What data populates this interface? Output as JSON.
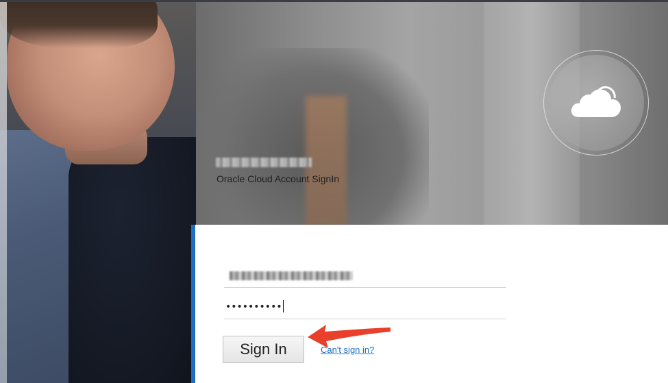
{
  "hero": {
    "account_name": "",
    "title": "Oracle Cloud Account SignIn",
    "badge_icon": "cloud-icon"
  },
  "form": {
    "username_value": "",
    "password_value": "••••••••••",
    "signin_label": "Sign In",
    "cant_signin_label": "Can't sign in?"
  },
  "colors": {
    "accent": "#1d6fc4",
    "annotation_arrow": "#e8402a"
  }
}
